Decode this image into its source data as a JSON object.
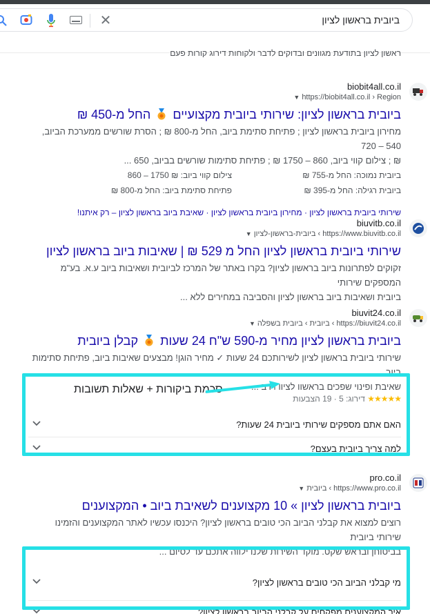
{
  "search": {
    "query": "ביובית בראשון לציון"
  },
  "top_cut_text": "ראשון לציון בתודעת מגוונים ובדוקים לדבר ולקוחות דירוג קורות פעם",
  "results": [
    {
      "site_name": "biobit4all.co.il",
      "url": "https://biobit4all.co.il › Region",
      "title_a": "ביובית בראשון לציון: שירותי ביובית מקצועיים",
      "title_b": "החל מ-450 ₪",
      "snippet_1": "מחירון ביובית בראשון לציון ; פתיחת סתימת ביוב, החל מ-800 ₪ ; הסרת שורשים ממערכת הביוב, 540 – 720",
      "snippet_2": "₪ ; צילום קווי ביוב, 860 – 1750 ₪ ; פתיחת סתימות שורשים בביוב, 650 ...",
      "facts": [
        "ביובית נמוכה: החל מ-755 ₪",
        "צילום קווי ביוב: ₪ 1750 – 860",
        "ביובית רגילה: החל מ-395 ₪",
        "פתיחת סתימת ביוב: החל מ-800 ₪"
      ],
      "sitelinks": "שירותי ביובית בראשון לציון · מחירון ביובית בראשון לציון · שאיבת ביוב בראשון לציון – רק איתנו!"
    },
    {
      "site_name": "biuvitb.co.il",
      "url": "https://www.biuvitb.co.il › ביובית-בראשון-לציון",
      "title": "שירותי ביובית בראשון לציון החל מ 529 ₪ | שאיבות ביוב בראשון לציון",
      "snippet_1": "זקוקים לפתרונות ביוב בראשון לציון? בקרו באתר של המרכז לביובית ושאיבות ביוב ע.א. בע\"מ המספקים שירותי",
      "snippet_2": "ביובית ושאיבות ביוב בראשון לציון והסביבה במחירים ללא ..."
    },
    {
      "site_name": "biuvit24.co.il",
      "url": "https://biuvit24.co.il › ביובית › ביובית בשפלה",
      "title_a": "ביובית בראשון לציון מחיר מ-590 ש\"ח 24 שעות",
      "title_b": "קבלן ביובית",
      "snippet_1": "שירותי ביובית בראשון לציון לשירותכם 24 שעות ✓ מחיר הוגן! מבצעים שאיבות ביוב, פתיחת סתימות ביוב,",
      "snippet_2": "שאיבת ופינוי שפכים בראשון לציון | רב ...",
      "rating": "דירוג: 5 · 19 הצבעות",
      "stars": "★★★★★",
      "faqs": [
        "האם אתם מספקים שירותי ביובית 24 שעות?",
        "למה צריך ביובית בעצם?"
      ]
    },
    {
      "site_name": "pro.co.il",
      "url": "https://www.pro.co.il › ביובית",
      "title": "ביובית בראשון לציון » 10 מקצוענים לשאיבת ביוב • המקצוענים",
      "snippet_1": "רוצים למצוא את קבלני הביוב הכי טובים בראשון לציון? היכנסו עכשיו לאתר המקצוענים והזמינו שירותי ביובית",
      "snippet_2": "בביטוחן ובראש שקט. מוקד השירות שלנו ילווה אתכם עד לסיום ...",
      "faqs": [
        "מי קבלני הביוב הכי טובים בראשון לציון?",
        "איך המקצוענים מפקחים על קבלני הביוב בראשון לציון?"
      ]
    }
  ],
  "annotation": {
    "label": "סכמת ביקורות + שאלות תשובות"
  },
  "colors": {
    "highlight": "#26e0e6",
    "link": "#1a0dab",
    "star": "#fbbc04"
  }
}
